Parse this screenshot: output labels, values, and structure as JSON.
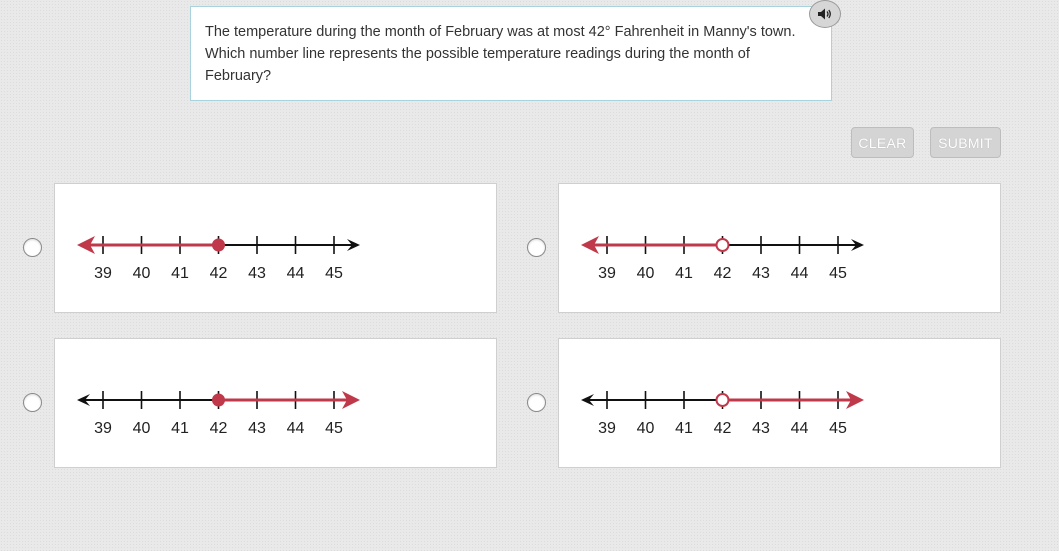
{
  "question": {
    "text": "The temperature during the month of February was at most 42° Fahrenheit in Manny's town. Which number line represents the possible temperature readings during the month of February?",
    "audio_icon": "speaker-icon"
  },
  "buttons": {
    "clear_label": "CLEAR",
    "submit_label": "SUBMIT"
  },
  "colors": {
    "shaded": "#c0394b",
    "axis": "#111111"
  },
  "number_line": {
    "tick_labels": [
      "39",
      "40",
      "41",
      "42",
      "43",
      "44",
      "45"
    ],
    "point_value": 42
  },
  "options": [
    {
      "direction": "left",
      "endpoint": "closed",
      "selected": false
    },
    {
      "direction": "left",
      "endpoint": "open",
      "selected": false
    },
    {
      "direction": "right",
      "endpoint": "closed",
      "selected": false
    },
    {
      "direction": "right",
      "endpoint": "open",
      "selected": false
    }
  ]
}
